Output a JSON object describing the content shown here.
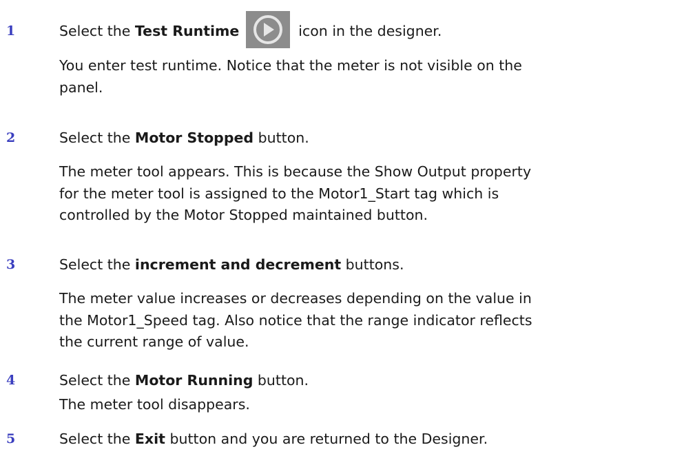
{
  "steps": [
    {
      "number": "1",
      "instruction": {
        "pre": "Select the ",
        "bold": "Test Runtime",
        "post": "icon in the designer."
      },
      "icon": "play-button-icon",
      "result_lines": [
        "You enter test runtime. Notice that the meter is not visible on the",
        "panel."
      ]
    },
    {
      "number": "2",
      "instruction": {
        "pre": "Select the ",
        "bold": "Motor Stopped",
        "post": " button."
      },
      "result_lines": [
        "The meter tool appears. This is because the Show Output property",
        "for the meter tool is assigned to the Motor1_Start tag which is",
        "controlled by the Motor Stopped maintained button."
      ]
    },
    {
      "number": "3",
      "instruction": {
        "pre": "Select the ",
        "bold": "increment and decrement",
        "post": " buttons."
      },
      "result_lines": [
        "The meter value increases or decreases depending on the value in",
        "the Motor1_Speed tag. Also notice that the range indicator reflects",
        "the current range of value."
      ]
    },
    {
      "number": "4",
      "instruction": {
        "pre": "Select the ",
        "bold": "Motor Running",
        "post": " button."
      },
      "result_lines": [
        "The meter tool disappears."
      ]
    },
    {
      "number": "5",
      "instruction": {
        "pre": "Select the ",
        "bold": "Exit",
        "post": " button and you are returned to the Designer."
      },
      "result_lines": []
    }
  ]
}
